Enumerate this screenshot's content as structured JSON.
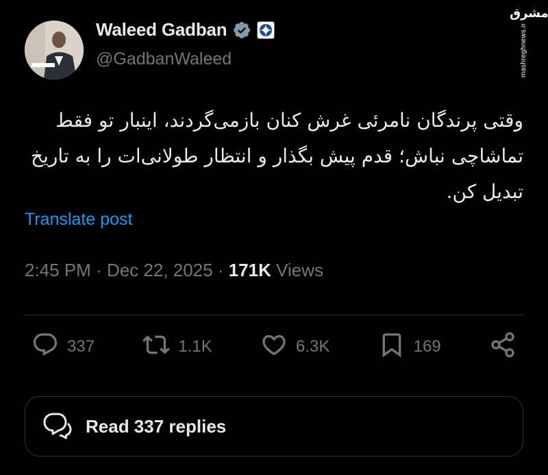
{
  "author": {
    "name": "Waleed Gadban",
    "handle": "@GadbanWaleed",
    "verified_icon": "verified-check-icon",
    "org_badge_icon": "organization-badge-icon"
  },
  "watermark": {
    "logo_text": "مشرق",
    "url": "mashreghnews.ir"
  },
  "tweet": {
    "text": "وقتی پرندگان نامرئی غرش کنان بازمی‌گردند، اینبار تو فقط تماشاچی نباش؛ قدم پیش بگذار و انتظار طولانی‌ات را به تاریخ تبدیل کن.",
    "translate_label": "Translate post"
  },
  "meta": {
    "time": "2:45 PM",
    "sep1": " · ",
    "date": "Dec 22, 2025",
    "sep2": " · ",
    "views_count": "171K",
    "views_label": " Views"
  },
  "actions": {
    "replies": "337",
    "reposts": "1.1K",
    "likes": "6.3K",
    "bookmarks": "169"
  },
  "read_replies_label": "Read 337 replies",
  "colors": {
    "background": "#000000",
    "text": "#e7e9ea",
    "secondary": "#71767b",
    "link": "#1d9bf0",
    "border": "#2f3336"
  }
}
